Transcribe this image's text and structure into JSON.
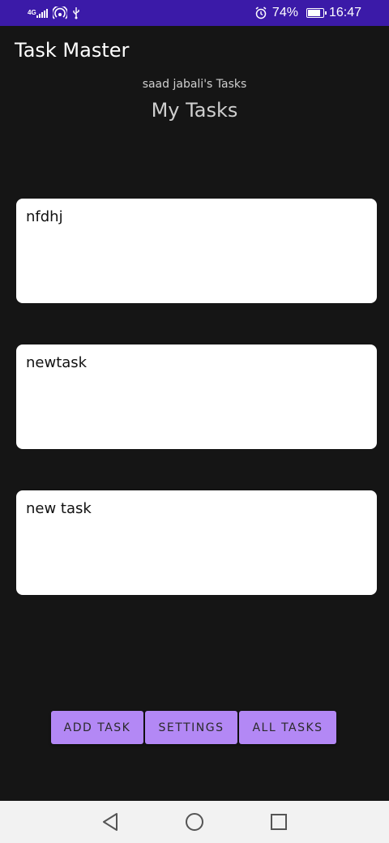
{
  "status_bar": {
    "network": "4G",
    "hotspot_icon": "hotspot-icon",
    "usb_icon": "usb-icon",
    "alarm_icon": "alarm-icon",
    "battery_percent": "74%",
    "battery_level": 0.74,
    "time": "16:47"
  },
  "app": {
    "title": "Task Master"
  },
  "header": {
    "user_tasks": "saad jabali's Tasks",
    "heading": "My Tasks"
  },
  "tasks": [
    {
      "title": "nfdhj"
    },
    {
      "title": "newtask"
    },
    {
      "title": "new task"
    }
  ],
  "buttons": {
    "add_task": "ADD TASK",
    "settings": "SETTINGS",
    "all_tasks": "ALL TASKS"
  },
  "nav": {
    "back_icon": "back-icon",
    "home_icon": "home-icon",
    "recents_icon": "recents-icon"
  },
  "colors": {
    "status_bar": "#3b1aa8",
    "background": "#151515",
    "button": "#b388f5",
    "card": "#ffffff"
  }
}
